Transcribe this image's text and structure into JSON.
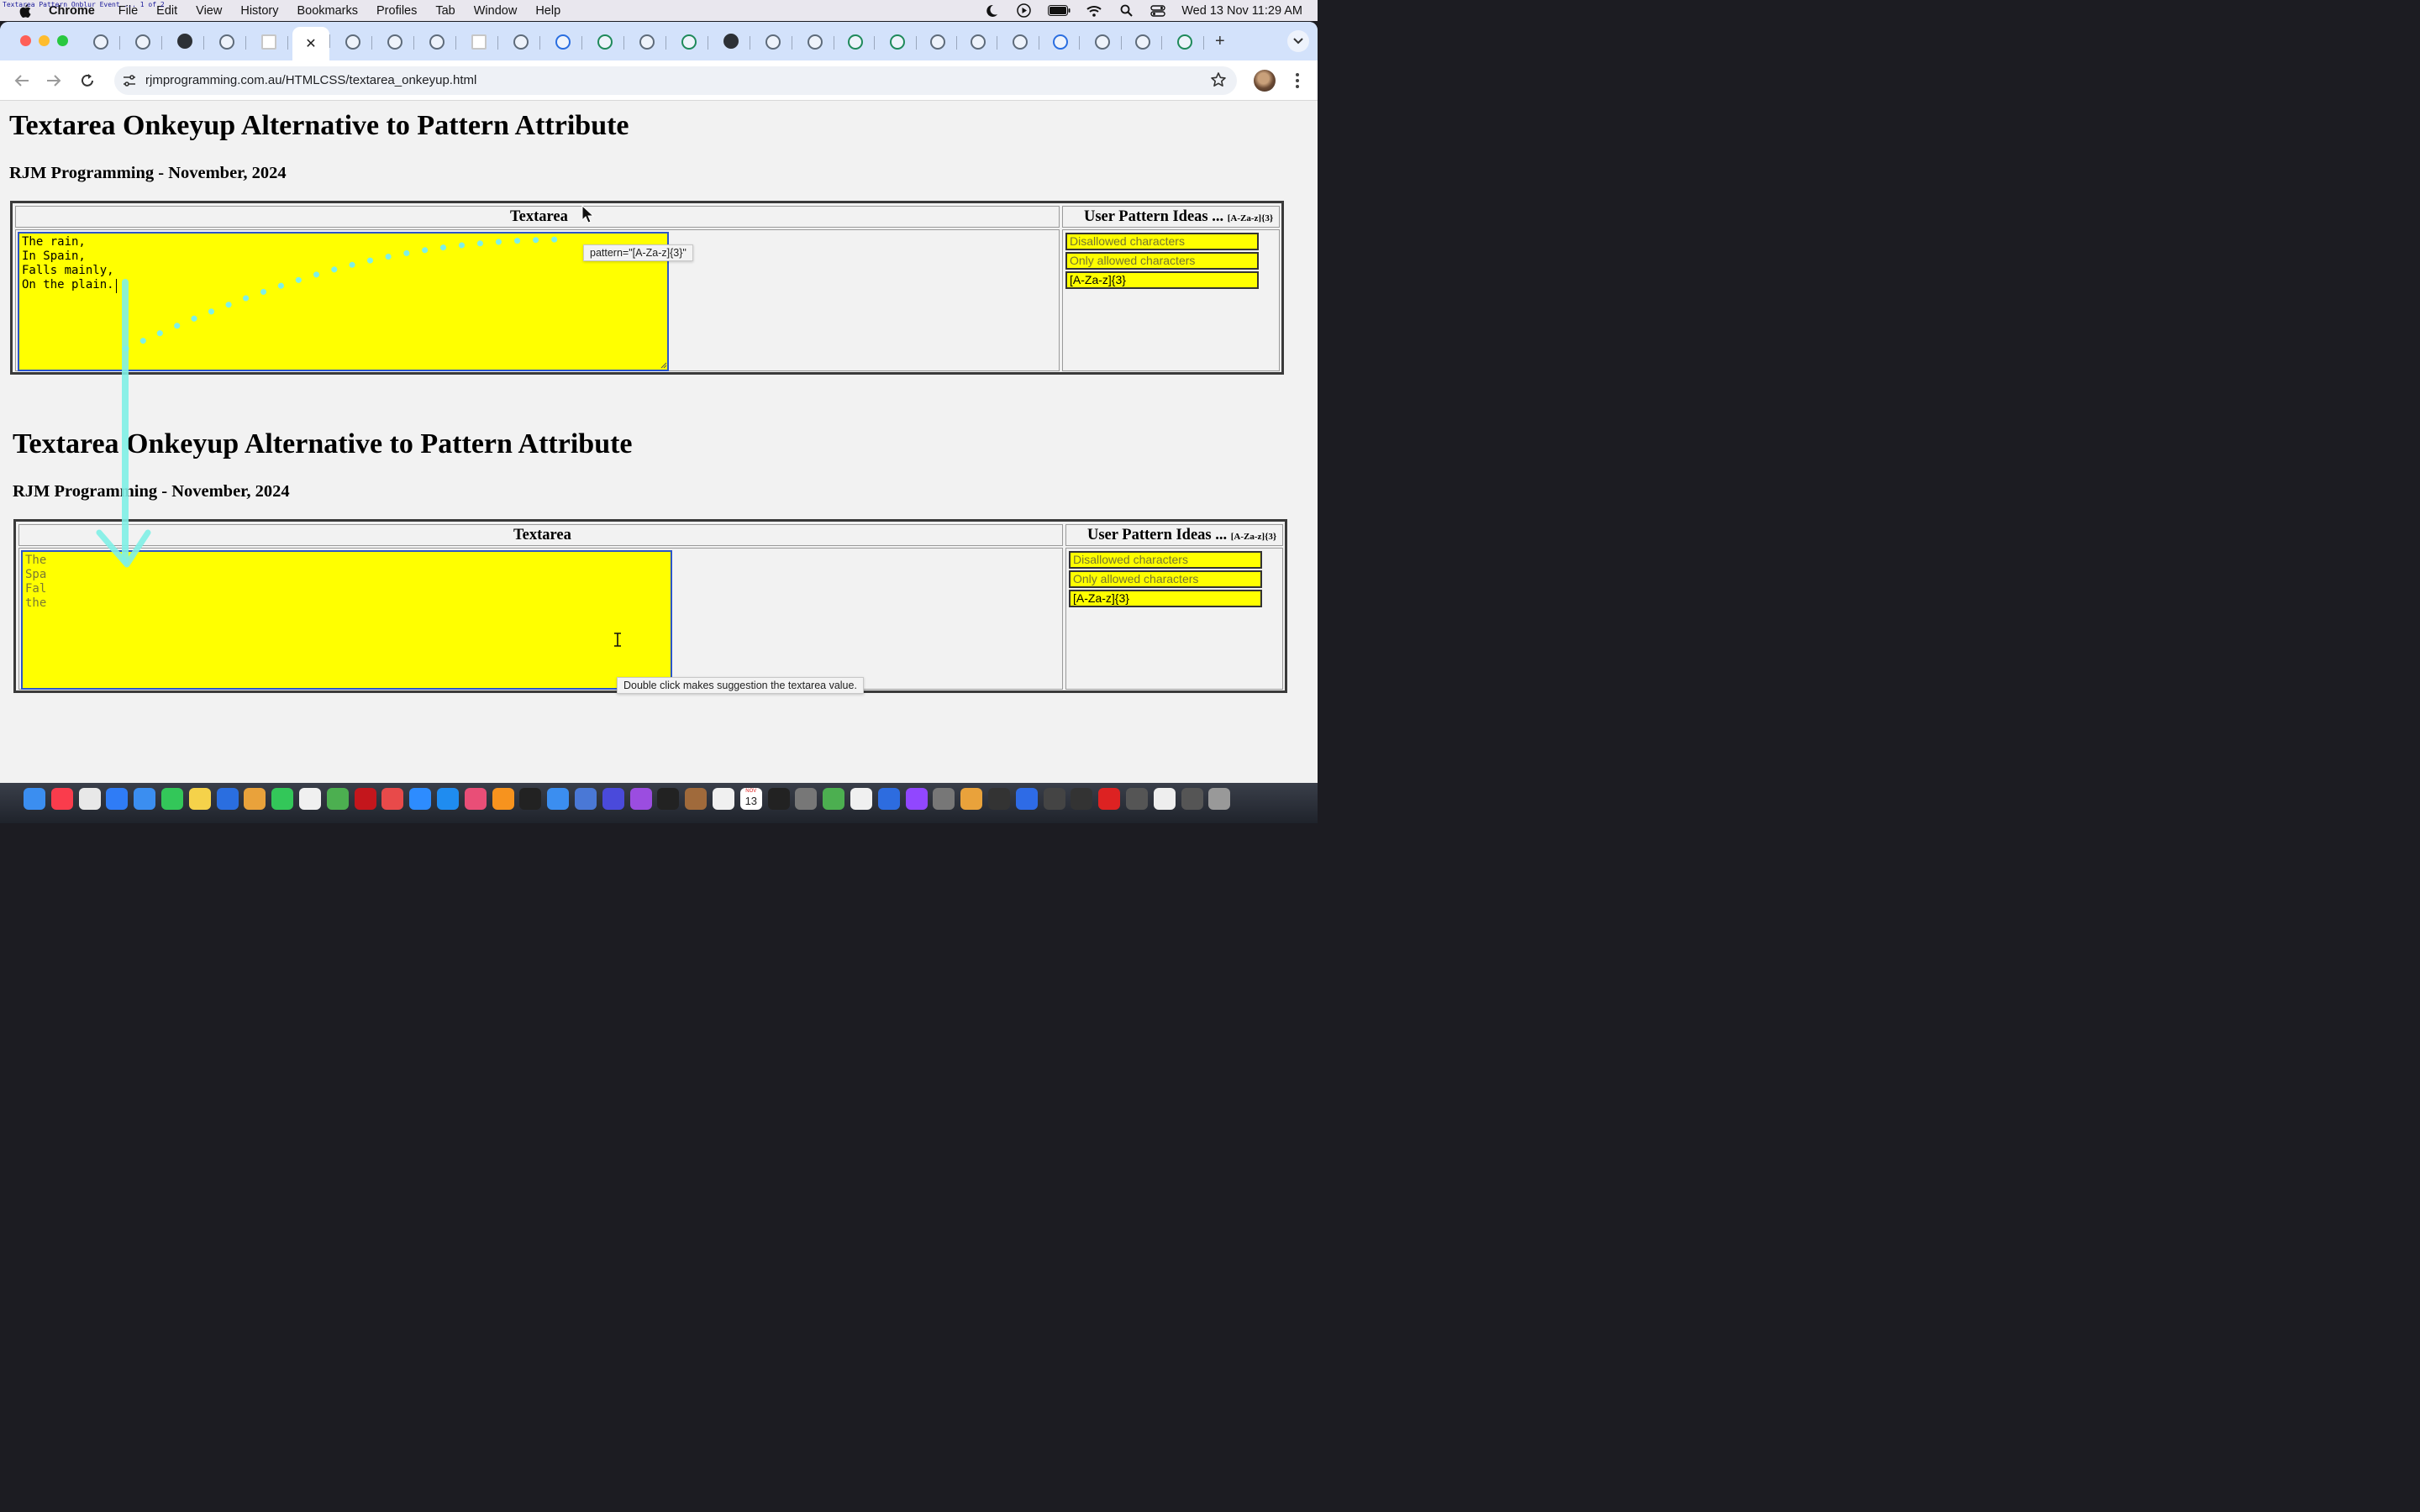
{
  "window_title": "Textarea Pattern Onblur Event ... 1 of 2",
  "menubar": {
    "app": "Chrome",
    "items": [
      "File",
      "Edit",
      "View",
      "History",
      "Bookmarks",
      "Profiles",
      "Tab",
      "Window",
      "Help"
    ],
    "clock": "Wed 13 Nov  11:29 AM"
  },
  "browser": {
    "url": "rjmprogramming.com.au/HTMLCSS/textarea_onkeyup.html",
    "active_tab_close": "✕",
    "new_tab": "+"
  },
  "top_page": {
    "title": "Textarea Onkeyup Alternative to Pattern Attribute",
    "subtitle": "RJM Programming - November, 2024",
    "th_textarea": "Textarea",
    "th_ideas": "User Pattern Ideas ...",
    "th_ideas_small": "[A-Za-z]{3}",
    "textarea_value": "The rain,\nIn Spain,\nFalls mainly,\nOn the plain.",
    "pattern_buttons": [
      "Disallowed characters",
      "Only allowed characters"
    ],
    "pattern_value": "[A-Za-z]{3}",
    "tooltip": "pattern=\"[A-Za-z]{3}\""
  },
  "bottom_page": {
    "title": "Textarea Onkeyup Alternative to Pattern Attribute",
    "subtitle": "RJM Programming - November, 2024",
    "th_textarea": "Textarea",
    "th_ideas": "User Pattern Ideas ...",
    "th_ideas_small": "[A-Za-z]{3}",
    "textarea_value": "The\nSpa\nFal\nthe",
    "pattern_buttons": [
      "Disallowed characters",
      "Only allowed characters"
    ],
    "pattern_value": "[A-Za-z]{3}",
    "tooltip": "Double click makes suggestion the textarea value."
  },
  "colors": {
    "textarea_bg": "#ffff00",
    "annotation": "#7ff0e6",
    "tab_strip": "#d3e2fb"
  },
  "dock_calendar": {
    "month": "NOV",
    "day": "13"
  }
}
